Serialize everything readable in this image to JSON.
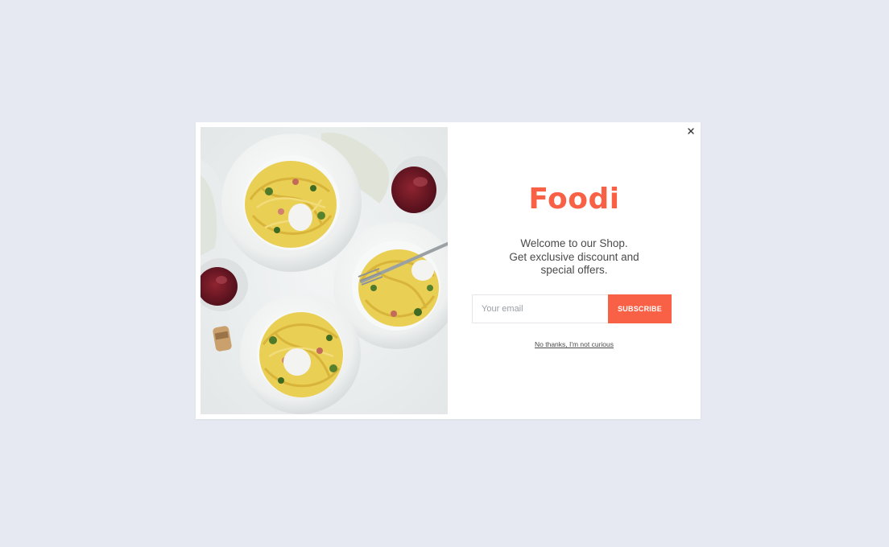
{
  "popup": {
    "brand": "Foodi",
    "message_lines": [
      "Welcome to our Shop.",
      "Get exclusive discount and",
      "special offers."
    ],
    "email_placeholder": "Your email",
    "email_value": "",
    "subscribe_label": "SUBSCRIBE",
    "decline_link": "No thanks, I'm not curious",
    "close_icon": "close-icon",
    "image": "pasta-dishes-photo"
  },
  "colors": {
    "page_background": "#e6e9f1",
    "modal_background": "#ffffff",
    "accent": "#f86145",
    "text": "#4a4a4a"
  }
}
